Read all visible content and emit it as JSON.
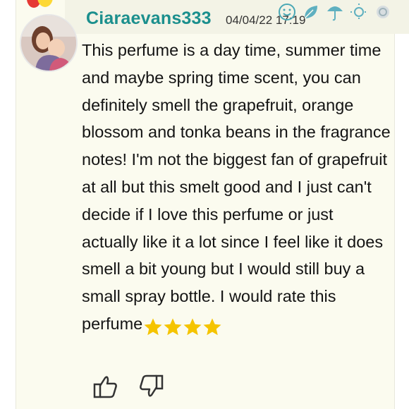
{
  "post": {
    "username": "Ciaraevans333",
    "timestamp": "04/04/22 17:19",
    "body": "This perfume is a day time, summer time and maybe spring time scent, you can definitely smell the grapefruit, orange blossom and tonka beans in the fragrance notes! I'm not the biggest fan of grapefruit at all but this smelt good and I just can't decide if I love this perfume or just actually like it a lot since I feel like it does smell a bit young but I would still buy a small spray bottle. I would rate this perfume",
    "rating_stars": 4
  },
  "icons": {
    "header": [
      "smile-icon",
      "leaf-icon",
      "umbrella-icon",
      "sun-icon",
      "moon-icon"
    ],
    "actions": [
      "thumbs-up-icon",
      "thumbs-down-icon"
    ]
  },
  "colors": {
    "username": "#1b8f8d",
    "card_bg": "#fbfbef",
    "star": "#f5c400",
    "icon": "#4aa8b5"
  }
}
